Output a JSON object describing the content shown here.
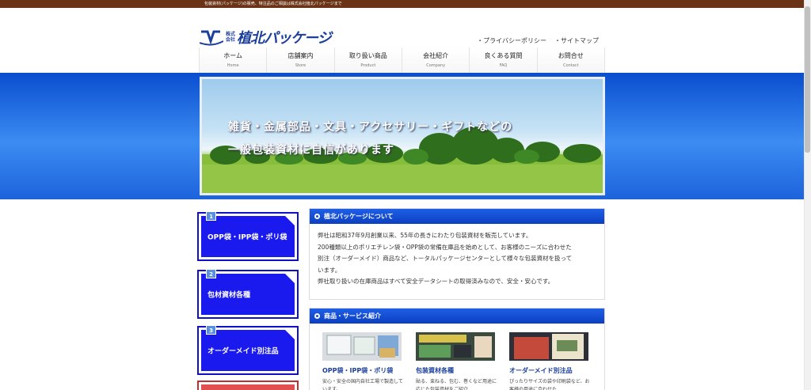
{
  "topbar": {
    "text": "包装資材(パッケージ)の販売、特注品のご相談は株式会社植北パッケージまで"
  },
  "logo": {
    "small_top": "株式",
    "small_bottom": "会社",
    "name": "植北パッケージ"
  },
  "header_links": [
    "・プライバシーポリシー",
    "・サイトマップ"
  ],
  "nav": [
    {
      "jp": "ホーム",
      "en": "Home"
    },
    {
      "jp": "店舗案内",
      "en": "Store"
    },
    {
      "jp": "取り扱い商品",
      "en": "Product"
    },
    {
      "jp": "会社紹介",
      "en": "Company"
    },
    {
      "jp": "良くある質問",
      "en": "FAQ"
    },
    {
      "jp": "お問合せ",
      "en": "Contact"
    }
  ],
  "hero": {
    "line1": "雑貨・金属部品・文具・アクセサリー・ギフトなどの",
    "line2": "一般包装資材に自信があります"
  },
  "sidebar": [
    {
      "num": "1",
      "label": "OPP袋・IPP袋・ポリ袋"
    },
    {
      "num": "2",
      "label": "包材資材各種"
    },
    {
      "num": "3",
      "label": "オーダーメイド別注品"
    }
  ],
  "about": {
    "title": "植北パッケージについて",
    "lines": [
      "弊社は昭和37年9月創業以来、55年の長きにわたり包装資材を販売しています。",
      "200種類以上のポリエチレン袋・OPP袋の常備在庫品を始めとして、お客様のニーズに合わせた",
      "別注（オーダーメイド）商品など、トータルパッケージセンターとして様々な包装資材を扱って",
      "います。",
      "弊社取り扱いの在庫商品はすべて安全データシートの取得済みなので、安全・安心です。"
    ]
  },
  "services": {
    "title": "商品・サービス紹介",
    "items": [
      {
        "title": "OPP袋・IPP袋・ポリ袋",
        "desc": "安心・安全の国内自社工場で製造しています。"
      },
      {
        "title": "包装資材各種",
        "desc": "貼る、束ねる、包む、巻くなど用途に応じた包装資材をご紹介"
      },
      {
        "title": "オーダーメイド別注品",
        "desc": "ぴったりサイズの袋や印刷袋など、お客様の用途に合わせた"
      }
    ]
  },
  "colors": {
    "brand_blue": "#1b3f9b",
    "topbar_brown": "#6b3417",
    "side_blue": "#1a1aee"
  }
}
